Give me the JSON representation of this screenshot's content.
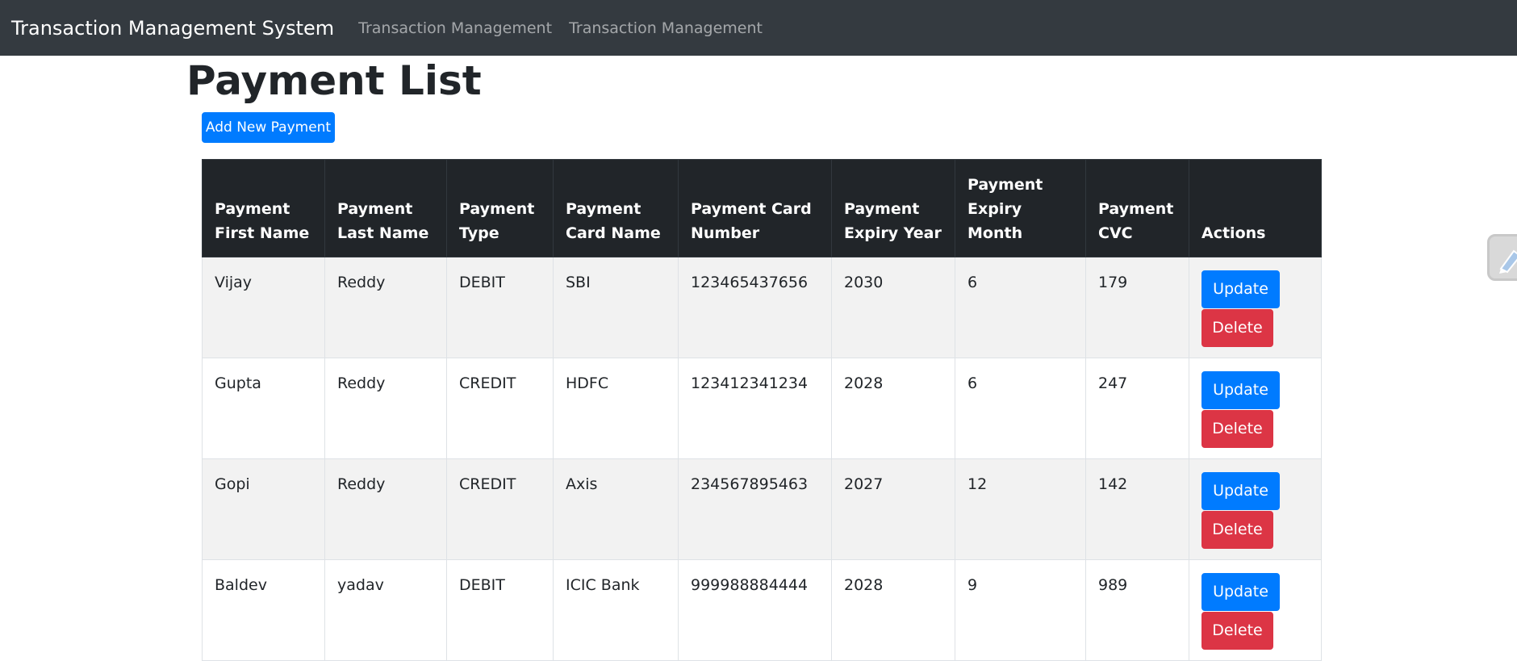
{
  "navbar": {
    "brand": "Transaction Management System",
    "links": [
      "Transaction Management",
      "Transaction Management"
    ]
  },
  "page": {
    "title": "Payment List",
    "add_button": "Add New Payment"
  },
  "table": {
    "headers": [
      "Payment First Name",
      "Payment Last Name",
      "Payment Type",
      "Payment Card Name",
      "Payment Card Number",
      "Payment Expiry Year",
      "Payment Expiry Month",
      "Payment CVC",
      "Actions"
    ],
    "rows": [
      [
        "Vijay",
        "Reddy",
        "DEBIT",
        "SBI",
        "123465437656",
        "2030",
        "6",
        "179"
      ],
      [
        "Gupta",
        "Reddy",
        "CREDIT",
        "HDFC",
        "123412341234",
        "2028",
        "6",
        "247"
      ],
      [
        "Gopi",
        "Reddy",
        "CREDIT",
        "Axis",
        "234567895463",
        "2027",
        "12",
        "142"
      ],
      [
        "Baldev",
        "yadav",
        "DEBIT",
        "ICIC Bank",
        "999988884444",
        "2028",
        "9",
        "989"
      ]
    ],
    "actions": {
      "update": "Update",
      "delete": "Delete"
    }
  },
  "colors": {
    "navbar": "#343a40",
    "table_header": "#212529",
    "primary": "#007bff",
    "danger": "#dc3545",
    "striped_row": "#f2f2f2"
  },
  "icons": {
    "side_widget": "extension-edit-icon"
  }
}
